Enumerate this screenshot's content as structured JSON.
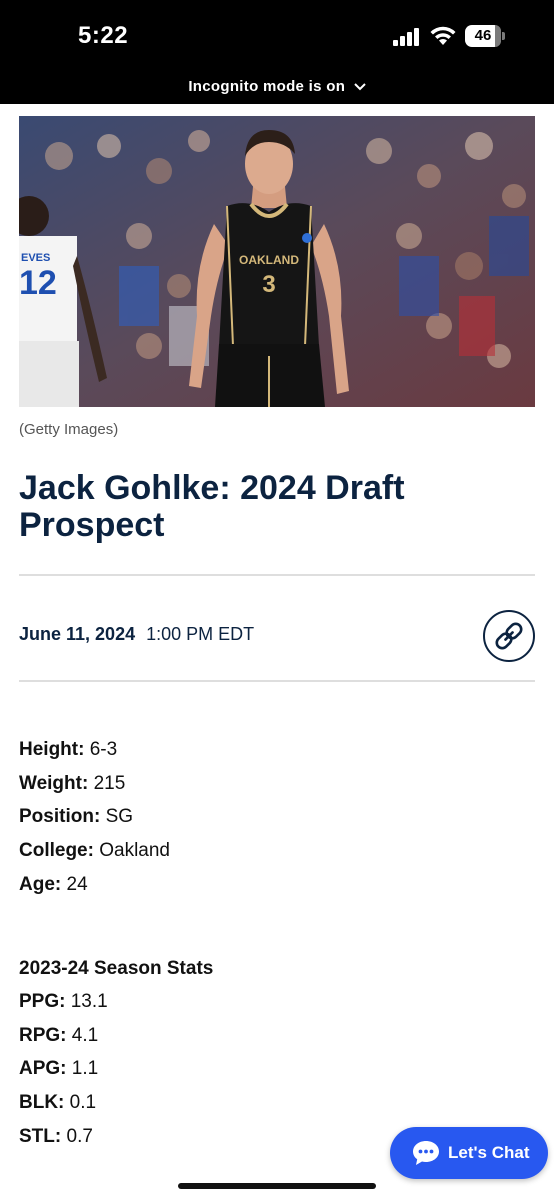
{
  "status_bar": {
    "time": "5:22",
    "battery": "46",
    "incognito_text": "Incognito mode is on"
  },
  "hero": {
    "caption": "(Getty Images)",
    "jersey_team": "OAKLAND",
    "jersey_number": "3",
    "opponent_name": "EVES",
    "opponent_number": "12"
  },
  "article": {
    "title": "Jack Gohlke: 2024 Draft Prospect",
    "date": "June 11, 2024",
    "time": "1:00 PM EDT"
  },
  "bio": [
    {
      "label": "Height:",
      "value": "6-3"
    },
    {
      "label": "Weight:",
      "value": "215"
    },
    {
      "label": "Position:",
      "value": "SG"
    },
    {
      "label": "College:",
      "value": "Oakland"
    },
    {
      "label": "Age:",
      "value": "24"
    }
  ],
  "season_stats": {
    "heading": "2023-24 Season Stats",
    "items": [
      {
        "label": "PPG:",
        "value": "13.1"
      },
      {
        "label": "RPG:",
        "value": "4.1"
      },
      {
        "label": "APG:",
        "value": "1.1"
      },
      {
        "label": "BLK:",
        "value": "0.1"
      },
      {
        "label": "STL:",
        "value": "0.7"
      }
    ]
  },
  "chat": {
    "label": "Let's Chat"
  },
  "colors": {
    "navy": "#0c2340",
    "chat_blue": "#2858f0",
    "gold": "#d4b87a"
  }
}
